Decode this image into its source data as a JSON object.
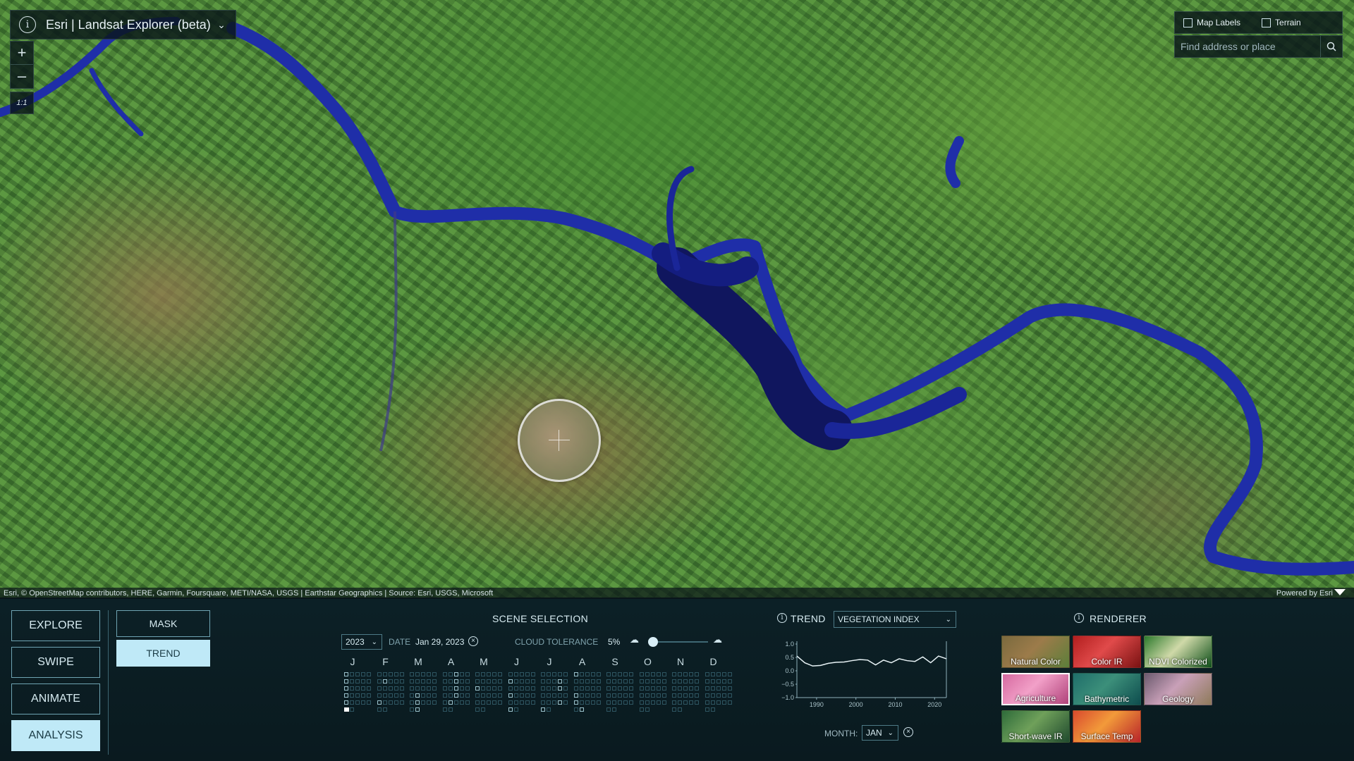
{
  "app": {
    "title": "Esri | Landsat Explorer (beta)"
  },
  "map_controls": {
    "zoom_in": "+",
    "zoom_out": "–",
    "scale_label": "1:1"
  },
  "toggles": {
    "map_labels": "Map Labels",
    "terrain": "Terrain"
  },
  "search": {
    "placeholder": "Find address or place"
  },
  "attribution": {
    "text": "Esri, © OpenStreetMap contributors, HERE, Garmin, Foursquare, METI/NASA, USGS | Earthstar Geographics | Source: Esri, USGS, Microsoft",
    "powered": "Powered by Esri"
  },
  "modes": [
    {
      "label": "EXPLORE",
      "active": false
    },
    {
      "label": "SWIPE",
      "active": false
    },
    {
      "label": "ANIMATE",
      "active": false
    },
    {
      "label": "ANALYSIS",
      "active": true
    }
  ],
  "analysis_tools": [
    {
      "label": "MASK",
      "active": false
    },
    {
      "label": "TREND",
      "active": true
    }
  ],
  "scene_selection": {
    "header": "SCENE SELECTION",
    "year": "2023",
    "date_label": "DATE",
    "date_value": "Jan 29, 2023",
    "cloud_label": "CLOUD TOLERANCE",
    "cloud_value": "5%",
    "cloud_fraction": 0.05,
    "months": [
      "J",
      "F",
      "M",
      "A",
      "M",
      "J",
      "J",
      "A",
      "S",
      "O",
      "N",
      "D"
    ]
  },
  "trend": {
    "header": "TREND",
    "index": "VEGETATION INDEX",
    "month_label": "MONTH:",
    "month_value": "JAN"
  },
  "chart_data": {
    "type": "line",
    "x": [
      1985,
      1987,
      1989,
      1991,
      1993,
      1995,
      1997,
      1999,
      2001,
      2003,
      2005,
      2007,
      2009,
      2011,
      2013,
      2015,
      2017,
      2019,
      2021,
      2023
    ],
    "series": [
      {
        "values": [
          0.55,
          0.3,
          0.18,
          0.2,
          0.28,
          0.32,
          0.33,
          0.38,
          0.42,
          0.4,
          0.22,
          0.4,
          0.3,
          0.45,
          0.38,
          0.35,
          0.52,
          0.3,
          0.55,
          0.45
        ]
      }
    ],
    "ylim": [
      -1.0,
      1.0
    ],
    "xlim": [
      1985,
      2023
    ],
    "yticks": [
      "1.0",
      "0.5",
      "0.0",
      "−0.5",
      "−1.0"
    ],
    "ytick_values": [
      1.0,
      0.5,
      0.0,
      -0.5,
      -1.0
    ],
    "xticks": [
      "1990",
      "2000",
      "2010",
      "2020"
    ],
    "xtick_values": [
      1990,
      2000,
      2010,
      2020
    ]
  },
  "renderer": {
    "header": "RENDERER",
    "items": [
      {
        "label": "Natural Color",
        "active": false,
        "colors": [
          "#7a6a3e",
          "#9c7b4a",
          "#5c7f3a"
        ]
      },
      {
        "label": "Color IR",
        "active": false,
        "colors": [
          "#b21e1e",
          "#e04a4a",
          "#7a1212"
        ]
      },
      {
        "label": "NDVI Colorized",
        "active": false,
        "colors": [
          "#2c7a2c",
          "#cfd9a8",
          "#0f4f1a"
        ]
      },
      {
        "label": "Agriculture",
        "active": true,
        "colors": [
          "#d66aa0",
          "#f2a0c8",
          "#b0427a"
        ]
      },
      {
        "label": "Bathymetric",
        "active": false,
        "colors": [
          "#1f6e6a",
          "#3c8f7a",
          "#0e4d4e"
        ]
      },
      {
        "label": "Geology",
        "active": false,
        "colors": [
          "#6b5a6e",
          "#c9a0b8",
          "#8e7a5a"
        ]
      },
      {
        "label": "Short-wave IR",
        "active": false,
        "colors": [
          "#2e6b3a",
          "#6fa05a",
          "#204a2e"
        ]
      },
      {
        "label": "Surface Temp",
        "active": false,
        "colors": [
          "#d94a2e",
          "#f29a3a",
          "#b8242a"
        ]
      }
    ]
  }
}
